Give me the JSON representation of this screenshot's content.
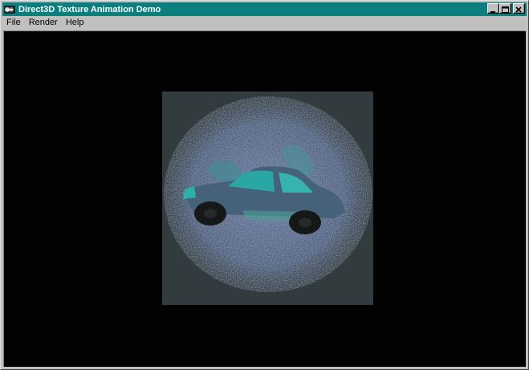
{
  "window": {
    "title": "Direct3D Texture Animation Demo",
    "titlebar_color": "#0a7f7e"
  },
  "menu": {
    "items": [
      {
        "label": "File"
      },
      {
        "label": "Render"
      },
      {
        "label": "Help"
      }
    ]
  },
  "viewport": {
    "background_color": "#020202",
    "surface_color": "#323b3d",
    "texture_colors": [
      "#5d6f96",
      "#2aa6a4",
      "#1a1a1a"
    ]
  }
}
